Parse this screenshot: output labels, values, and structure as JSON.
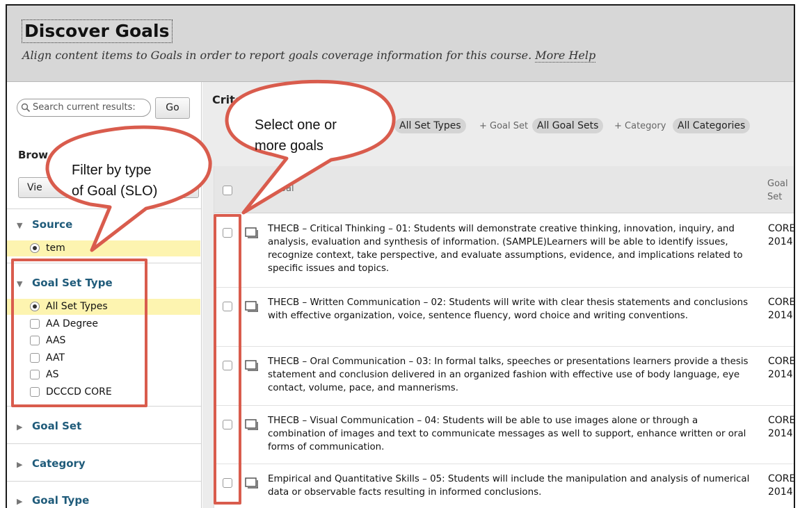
{
  "header": {
    "title": "Discover Goals",
    "subtitle": "Align content items to Goals in order to report goals coverage information for this course.",
    "help_link": "More Help"
  },
  "sidebar": {
    "search_placeholder": "Search current results:",
    "go_label": "Go",
    "browse_heading": "Brow",
    "view_button": "Vie",
    "sections": {
      "source": {
        "label": "Source",
        "selected": "System"
      },
      "goal_set_type": {
        "label": "Goal Set Type",
        "options": [
          "All Set Types",
          "AA Degree",
          "AAS",
          "AAT",
          "AS",
          "DCCCD CORE"
        ]
      },
      "goal_set": {
        "label": "Goal Set"
      },
      "category": {
        "label": "Category"
      },
      "goal_type": {
        "label": "Goal Type"
      }
    },
    "source_option_visible": "tem"
  },
  "criteria": {
    "title": "Crite",
    "set_type_value": "All Set Types",
    "goal_set_label": "+ Goal Set",
    "goal_set_value": "All Goal Sets",
    "category_label": "+ Category",
    "category_value": "All Categories"
  },
  "table": {
    "header_goal": "Goal",
    "header_goal_set": "Goal Set",
    "rows": [
      {
        "text": "THECB – Critical Thinking – 01: Students will demonstrate creative thinking, innovation, inquiry, and analysis, evaluation and synthesis of information. (SAMPLE)Learners will be able to identify issues, recognize context, take perspective, and evaluate assumptions, evidence, and implications related to specific issues and topics.",
        "set": "CORE 2014"
      },
      {
        "text": "THECB – Written Communication – 02: Students will write with clear thesis statements and conclusions with effective organization, voice, sentence fluency, word choice and writing conventions.",
        "set": "CORE 2014"
      },
      {
        "text": "THECB – Oral Communication – 03: In formal talks, speeches or presentations learners provide a thesis statement and conclusion delivered in an organized fashion with effective use of body language, eye contact, volume, pace, and mannerisms.",
        "set": "CORE 2014"
      },
      {
        "text": "THECB – Visual Communication – 04: Students will be able to use images alone or through a combination of images and text to communicate messages as well to support, enhance written or oral forms of communication.",
        "set": "CORE 2014"
      },
      {
        "text": "Empirical and Quantitative Skills – 05: Students will include the manipulation and analysis of numerical data or observable facts resulting in informed conclusions.",
        "set": "CORE 2014"
      }
    ]
  },
  "callouts": {
    "filter_line1": "Filter by type",
    "filter_line2": "of Goal (SLO)",
    "select_line1": "Select one or",
    "select_line2": "more goals"
  },
  "colors": {
    "accent_link": "#1f5b7a",
    "highlight": "#fdf4b0",
    "callout_border": "#d95c4d"
  }
}
